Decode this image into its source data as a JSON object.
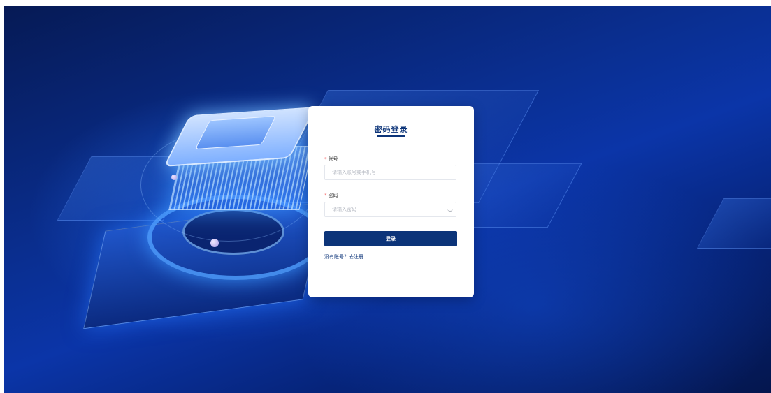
{
  "login_card": {
    "title": "密码登录",
    "account": {
      "label": "账号",
      "required_mark": "*",
      "placeholder": "请输入账号或手机号"
    },
    "password": {
      "label": "密码",
      "required_mark": "*",
      "placeholder": "请输入密码",
      "toggle_icon": "eye-closed-icon"
    },
    "submit_label": "登录",
    "register_prompt": "没有账号？",
    "register_link": "去注册"
  },
  "colors": {
    "brand": "#0c3479",
    "background_dark": "#061a55",
    "background_mid": "#0b35a8",
    "required": "#f56c6c"
  }
}
